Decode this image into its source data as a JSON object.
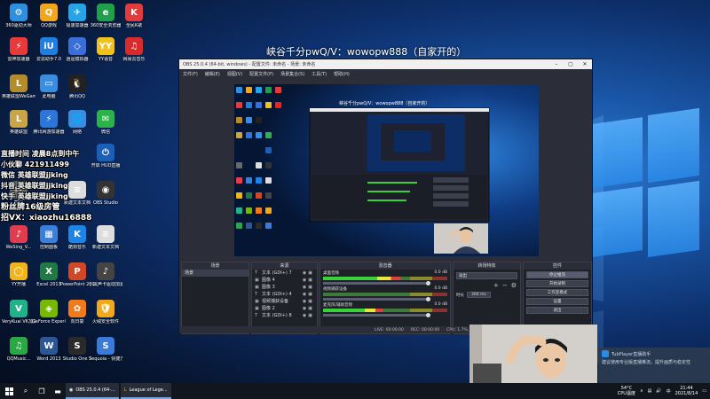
{
  "page_title": "峡谷千分pwQ/V：wowopw888（自家开的）",
  "desktop_icons": [
    {
      "label": "360驱动大师",
      "color": "#2d8fe0",
      "glyph": "⚙"
    },
    {
      "label": "QQ游戏",
      "color": "#f2a51d",
      "glyph": "Q"
    },
    {
      "label": "极速加速器",
      "color": "#27a3e8",
      "glyph": "✈"
    },
    {
      "label": "360安全浏览器",
      "color": "#1fa14b",
      "glyph": "e"
    },
    {
      "label": "全民K歌",
      "color": "#e33b3b",
      "glyph": "K"
    },
    {
      "label": "雷神加速器",
      "color": "#e83a3a",
      "glyph": "⚡"
    },
    {
      "label": "爱思助手7.0",
      "color": "#1e7fe0",
      "glyph": "iU"
    },
    {
      "label": "逍遥模拟器",
      "color": "#3a6ed8",
      "glyph": "◇"
    },
    {
      "label": "YY语音",
      "color": "#f2c21b",
      "glyph": "YY"
    },
    {
      "label": "网易云音乐",
      "color": "#d92b2b",
      "glyph": "♫"
    },
    {
      "label": "英雄联盟WeGame版",
      "color": "#b58c2b",
      "glyph": "L"
    },
    {
      "label": "此电脑",
      "color": "#3a8ee0",
      "glyph": "▭"
    },
    {
      "label": "腾讯QQ",
      "color": "#222222",
      "glyph": "🐧"
    },
    {
      "label": "英雄联盟",
      "color": "#c9a548",
      "glyph": "L"
    },
    {
      "label": "腾讯网游加速器",
      "color": "#2b76d8",
      "glyph": "⚡"
    },
    {
      "label": "网络",
      "color": "#3a8ee0",
      "glyph": "🌐"
    },
    {
      "label": "微信",
      "color": "#2bb34a",
      "glyph": "✉"
    },
    {
      "label": "开启 HUD直播",
      "color": "#1b5fb8",
      "glyph": "⏻"
    },
    {
      "label": "截图",
      "color": "#6a6a6a",
      "glyph": "✂"
    },
    {
      "label": "OBS Studio",
      "color": "#333333",
      "glyph": "◉"
    },
    {
      "label": "新建文本文档",
      "color": "#dddddd",
      "glyph": "≡"
    },
    {
      "label": "WeSing_V...",
      "color": "#e03c4e",
      "glyph": "♪"
    },
    {
      "label": "控制面板",
      "color": "#3a7fd8",
      "glyph": "▦"
    },
    {
      "label": "酷狗音乐",
      "color": "#1d84e8",
      "glyph": "K"
    },
    {
      "label": "新建文本文档",
      "color": "#dddddd",
      "glyph": "≡"
    },
    {
      "label": "YY开播",
      "color": "#f2b41b",
      "glyph": "◯"
    },
    {
      "label": "Excel 2013",
      "color": "#1f7a43",
      "glyph": "X"
    },
    {
      "label": "PowerPoint 2013",
      "color": "#d24726",
      "glyph": "P"
    },
    {
      "label": "小黑声卡驱动加速",
      "color": "#444444",
      "glyph": "♪"
    },
    {
      "label": "VeryKuai VK加速器",
      "color": "#1fb38c",
      "glyph": "V"
    },
    {
      "label": "GeForce Experience",
      "color": "#76b900",
      "glyph": "◈"
    },
    {
      "label": "向日葵",
      "color": "#f27a1b",
      "glyph": "✿"
    },
    {
      "label": "火绒安全软件",
      "color": "#f2a81b",
      "glyph": "🛡"
    },
    {
      "label": "QQMusic...",
      "color": "#2aa845",
      "glyph": "♫"
    },
    {
      "label": "Word 2013",
      "color": "#2b5797",
      "glyph": "W"
    },
    {
      "label": "Studio One 3",
      "color": "#2a2a2a",
      "glyph": "S"
    },
    {
      "label": "Sequoia - 快捷方式",
      "color": "#3a7ad8",
      "glyph": "S"
    }
  ],
  "overlay_lines": [
    "直播时间 凌晨8点到中午",
    "小伙聊 421911499",
    "微信 英雄联盟jjking",
    "抖音 英雄联盟jjking",
    "快手 英雄联盟jjking",
    "粉丝牌16级房管",
    "招VX：xiaozhu16888"
  ],
  "obs": {
    "window_title": "OBS 25.0.4 (64-bit, windows) - 配置文件: 未命名 - 场景: 未命名",
    "menu": [
      "文件(F)",
      "编辑(E)",
      "视图(V)",
      "配置文件(P)",
      "场景集合(S)",
      "工具(T)",
      "帮助(H)"
    ],
    "preview_title": "峡谷千分pwQ/V：wowopw888（自家开的）",
    "docks": {
      "scenes": {
        "header": "场景",
        "items": [
          "场景"
        ]
      },
      "sources": {
        "header": "来源",
        "items": [
          {
            "icon": "T",
            "label": "文本 (GDI+) 7"
          },
          {
            "icon": "▣",
            "label": "图像 4"
          },
          {
            "icon": "▣",
            "label": "图像 3"
          },
          {
            "icon": "T",
            "label": "文本 (GDI+) 4"
          },
          {
            "icon": "▣",
            "label": "视频捕获设备"
          },
          {
            "icon": "▣",
            "label": "图像 2"
          },
          {
            "icon": "T",
            "label": "文本 (GDI+) 8"
          }
        ]
      },
      "mixer": {
        "header": "混音器",
        "rows": [
          {
            "name": "桌面音频",
            "db": "0.0 dB",
            "level": 0.62
          },
          {
            "name": "视频捕获设备",
            "db": "0.0 dB",
            "level": 0.0
          },
          {
            "name": "麦克风/辅助音频",
            "db": "0.0 dB",
            "level": 0.48
          }
        ]
      },
      "transitions": {
        "header": "转场特效",
        "type": "淡出",
        "duration_label": "时长",
        "duration": "300 ms"
      },
      "controls": {
        "header": "控件",
        "buttons": [
          "停止推流",
          "开始录制",
          "工作室模式",
          "设置",
          "退出"
        ]
      }
    },
    "status": [
      "LIVE: 00:00:00",
      "REC: 00:00:00",
      "CPU: 1.7%, 30.00 fps"
    ]
  },
  "notification": {
    "title": "TubPlayer直播助手",
    "body": "建议使用专业版直播推流，提升画质与稳定性"
  },
  "taskbar": {
    "tasks": [
      "OBS 25.0.4 (64-...",
      "League of Lege..."
    ],
    "tray_temp": "54°C",
    "tray_temp_label": "CPU温度",
    "ime": "中",
    "time": "21:44",
    "date": "2021/8/14"
  },
  "colors": {
    "accent": "#2a8ae8",
    "obs_bg": "#2b2e38",
    "taskbar": "#11151d"
  }
}
